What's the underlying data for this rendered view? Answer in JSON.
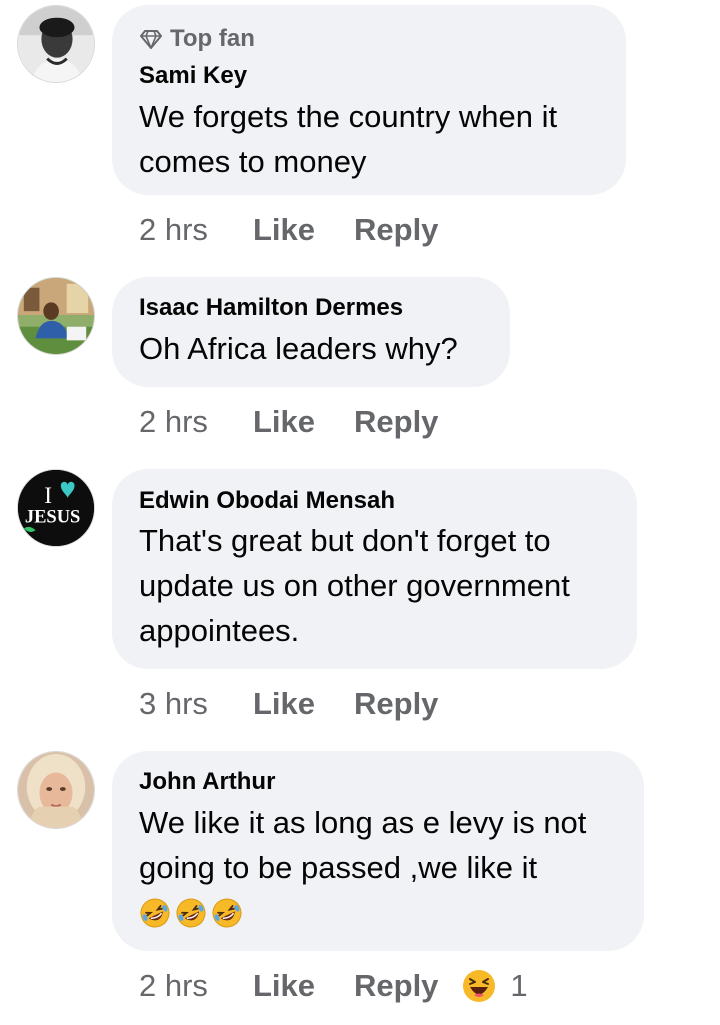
{
  "comments": [
    {
      "badge": "Top fan",
      "author": "Sami Key",
      "lines": [
        "We forgets the country when it",
        "comes to money"
      ],
      "time": "2 hrs",
      "like": "Like",
      "reply": "Reply"
    },
    {
      "author": "Isaac Hamilton Dermes",
      "lines": [
        "Oh Africa leaders why?"
      ],
      "time": "2 hrs",
      "like": "Like",
      "reply": "Reply"
    },
    {
      "author": "Edwin Obodai Mensah",
      "lines": [
        "That's great but don't forget to",
        "update us on other government",
        "appointees."
      ],
      "time": "3 hrs",
      "like": "Like",
      "reply": "Reply",
      "avatar_text": {
        "top": "I",
        "bottom": "JESUS"
      }
    },
    {
      "author": "John Arthur",
      "lines": [
        "We like it as long as e levy is not",
        "going to be passed ,we like it"
      ],
      "emojis": [
        "rolling-on-floor-laughing-emoji",
        "rolling-on-floor-laughing-emoji",
        "rolling-on-floor-laughing-emoji"
      ],
      "time": "2 hrs",
      "like": "Like",
      "reply": "Reply",
      "reaction": {
        "icon": "haha-reaction-icon",
        "count": "1"
      }
    }
  ],
  "colors": {
    "bubble": "#f0f2f5",
    "secondary_text": "#65676b",
    "primary_text": "#050505",
    "haha_yellow": "#f7b928"
  }
}
